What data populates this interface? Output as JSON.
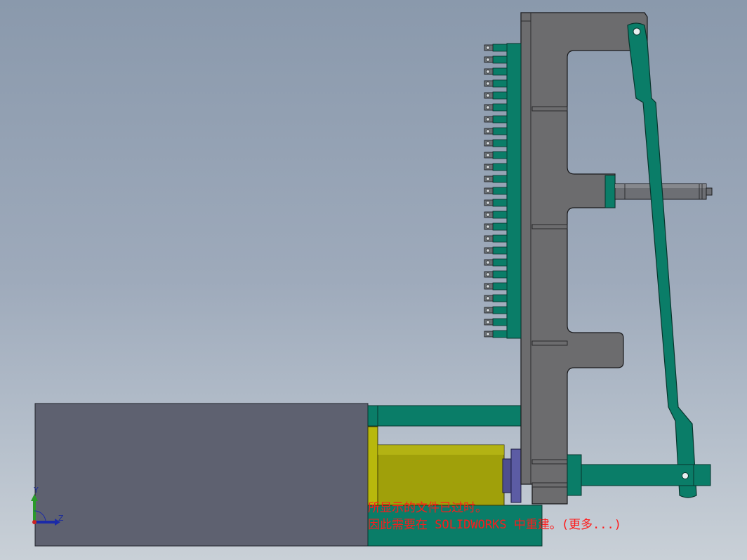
{
  "viewport": {
    "background_top": "#8a99ac",
    "background_bottom": "#c9d0d7"
  },
  "model": {
    "colors": {
      "housing": "#5e6170",
      "frame": "#6c6c6e",
      "teal": "#087a66",
      "yellow": "#a3a30a",
      "purple": "#5a5a9a",
      "shaft": "#6d6f74"
    },
    "clip_count": 25
  },
  "triad": {
    "y_label": "Y",
    "z_label": "Z",
    "x_color": "#1b2aa8",
    "y_color": "#2a9a2a"
  },
  "warning": {
    "line1": "所显示的文件已过时。",
    "line2": "因此需要在 SOLIDWORKS 中重建。(更多...)",
    "color": "#ff1a1a"
  }
}
